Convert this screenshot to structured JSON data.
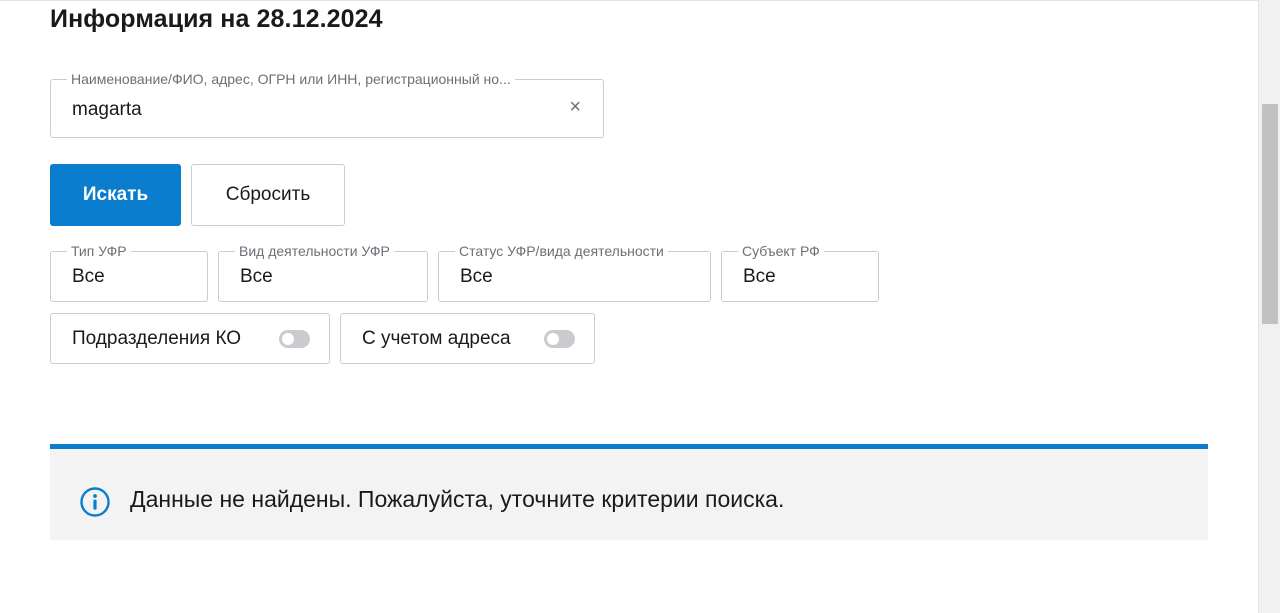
{
  "page": {
    "title": "Информация на 28.12.2024"
  },
  "search": {
    "label": "Наименование/ФИО, адрес, ОГРН или ИНН, регистрационный но...",
    "value": "magarta",
    "clear_icon": "×"
  },
  "buttons": {
    "search": "Искать",
    "reset": "Сбросить"
  },
  "filters": [
    {
      "label": "Тип УФР",
      "value": "Все"
    },
    {
      "label": "Вид деятельности УФР",
      "value": "Все"
    },
    {
      "label": "Статус УФР/вида деятельности",
      "value": "Все"
    },
    {
      "label": "Субъект РФ",
      "value": "Все"
    }
  ],
  "toggles": [
    {
      "label": "Подразделения КО",
      "on": false
    },
    {
      "label": "С учетом адреса",
      "on": false
    }
  ],
  "alert": {
    "icon": "info-icon",
    "text": "Данные не найдены. Пожалуйста, уточните критерии поиска."
  },
  "colors": {
    "accent": "#0b7dce",
    "alert_bg": "#f3f3f3"
  }
}
